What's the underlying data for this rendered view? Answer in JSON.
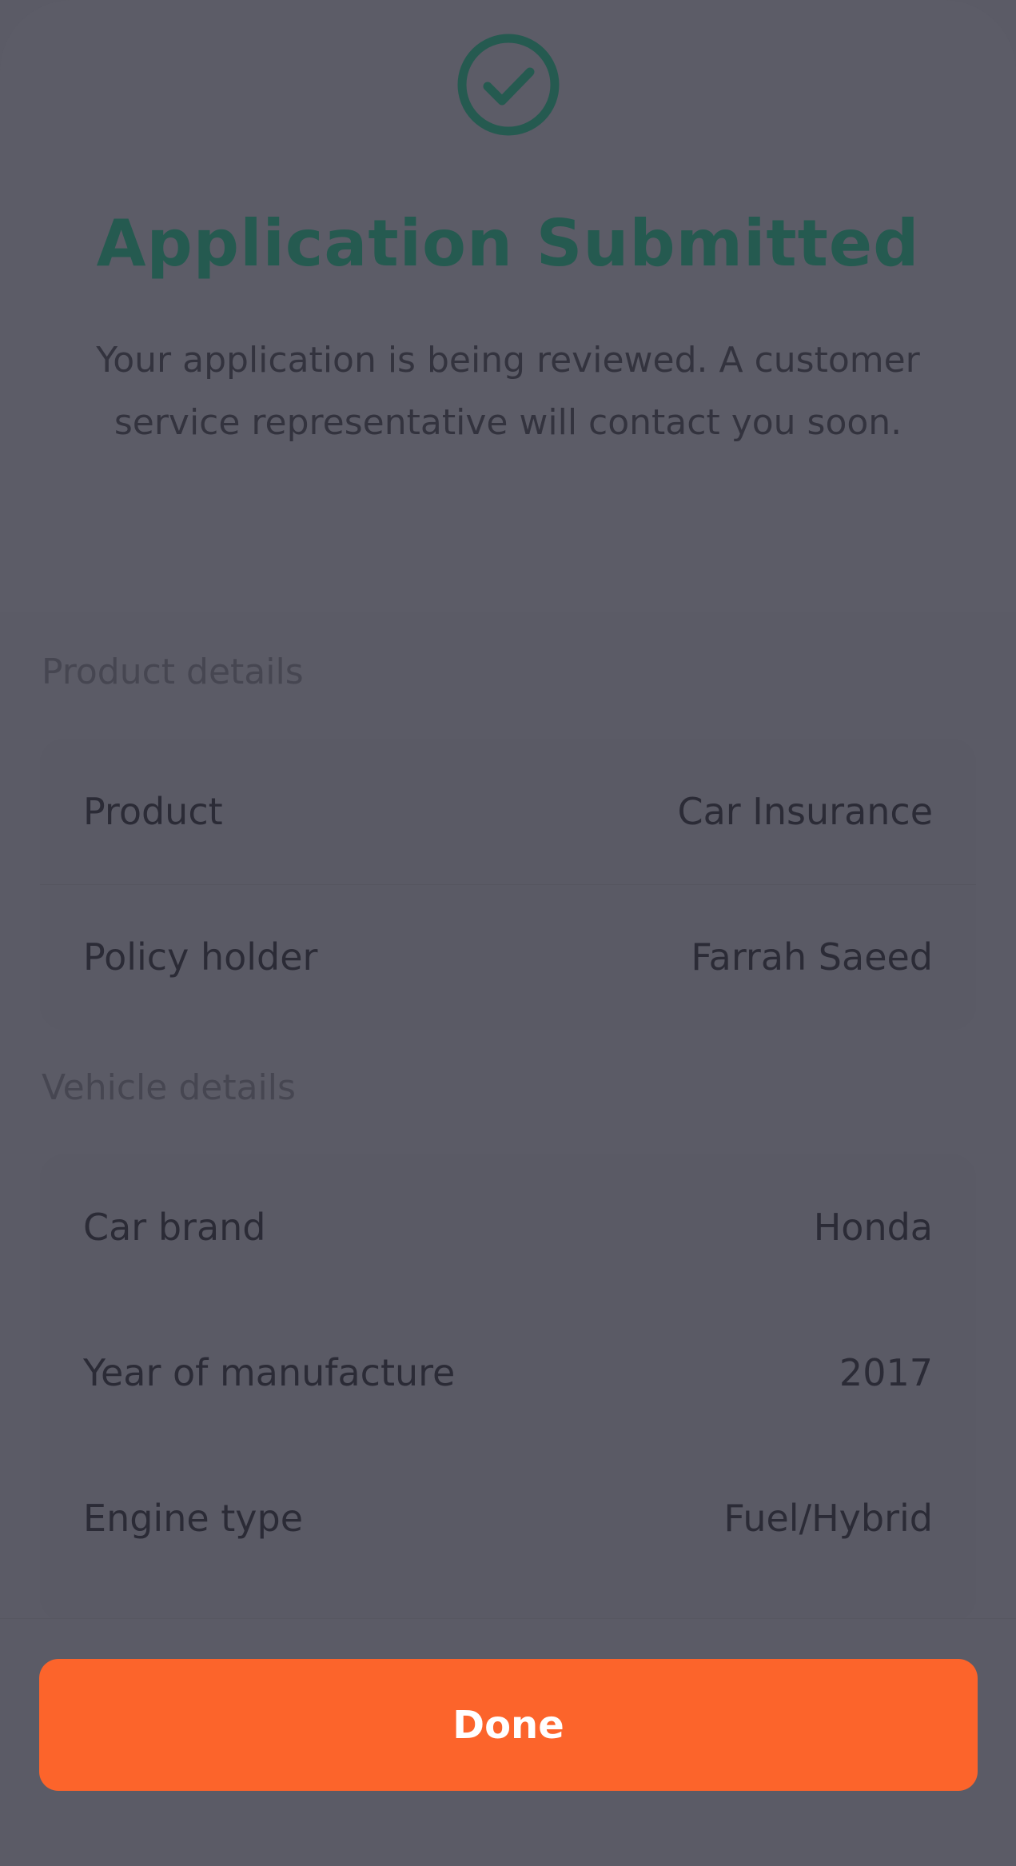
{
  "header": {
    "title": "Application Submitted",
    "subtitle": "Your application is being reviewed. A customer service representative will contact you soon.",
    "icon": "check-circle-icon"
  },
  "product_details": {
    "label": "Product details",
    "rows": [
      {
        "label": "Product",
        "value": "Car Insurance"
      },
      {
        "label": "Policy holder",
        "value": "Farrah Saeed"
      }
    ]
  },
  "vehicle_details": {
    "label": "Vehicle details",
    "rows": [
      {
        "label": "Car brand",
        "value": "Honda"
      },
      {
        "label": "Year of manufacture",
        "value": "2017"
      },
      {
        "label": "Engine type",
        "value": "Fuel/Hybrid"
      }
    ]
  },
  "footer": {
    "done_label": "Done"
  },
  "colors": {
    "accent": "#fc642b",
    "success": "#255a50",
    "overlay_background": "#5b5b66"
  }
}
